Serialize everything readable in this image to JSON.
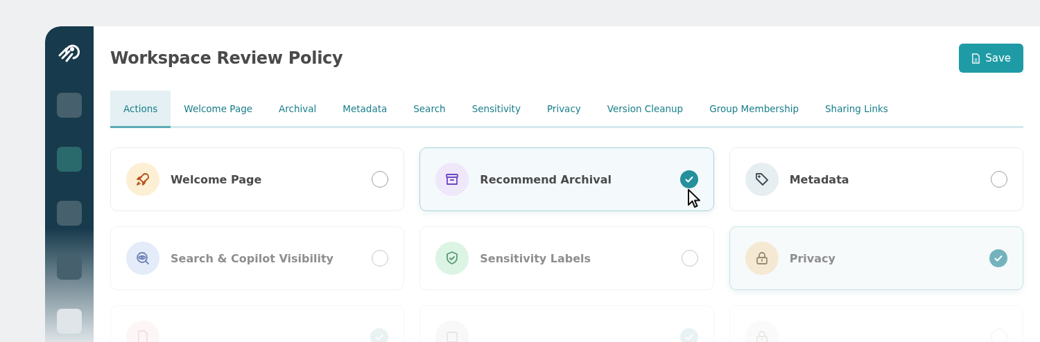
{
  "page": {
    "title": "Workspace Review Policy",
    "save_button": "Save"
  },
  "tabs": [
    {
      "label": "Actions",
      "selected": true
    },
    {
      "label": "Welcome Page",
      "selected": false
    },
    {
      "label": "Archival",
      "selected": false
    },
    {
      "label": "Metadata",
      "selected": false
    },
    {
      "label": "Search",
      "selected": false
    },
    {
      "label": "Sensitivity",
      "selected": false
    },
    {
      "label": "Privacy",
      "selected": false
    },
    {
      "label": "Version Cleanup",
      "selected": false
    },
    {
      "label": "Group Membership",
      "selected": false
    },
    {
      "label": "Sharing Links",
      "selected": false
    }
  ],
  "cards": [
    {
      "label": "Welcome Page",
      "color": "#fdefd3",
      "selected": false,
      "kind": "normal"
    },
    {
      "label": "Recommend Archival",
      "color": "#efe8fb",
      "selected": true,
      "kind": "normal"
    },
    {
      "label": "Metadata",
      "color": "#e6eef1",
      "selected": false,
      "kind": "normal"
    },
    {
      "label": "Search & Copilot Visibility",
      "color": "#e4ecf9",
      "selected": false,
      "kind": "dimmed"
    },
    {
      "label": "Sensitivity Labels",
      "color": "#dcf4e4",
      "selected": false,
      "kind": "dimmed"
    },
    {
      "label": "Privacy",
      "color": "#f5e9d4",
      "selected": true,
      "kind": "dimmed"
    },
    {
      "color": "#fdf6f6",
      "selected": true,
      "kind": "ghost"
    },
    {
      "color": "#f8f8f8",
      "selected": true,
      "kind": "ghost"
    },
    {
      "color": "#fafafa",
      "selected": false,
      "kind": "ghost"
    }
  ]
}
